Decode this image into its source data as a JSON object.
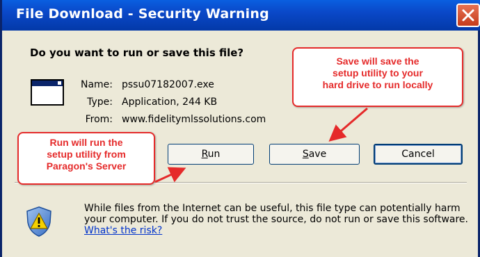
{
  "window": {
    "title": "File Download - Security Warning"
  },
  "dialog": {
    "question": "Do you want to run or save this file?",
    "name_label": "Name:",
    "name_value": "pssu07182007.exe",
    "type_label": "Type:",
    "type_value": "Application, 244 KB",
    "from_label": "From:",
    "from_value": "www.fidelitymlssolutions.com"
  },
  "buttons": {
    "run_hotkey": "R",
    "run_rest": "un",
    "save_hotkey": "S",
    "save_rest": "ave",
    "cancel": "Cancel"
  },
  "warning": {
    "text": "While files from the Internet can be useful, this file type can potentially harm your computer. If you do not trust the source, do not run or save this software.",
    "link": "What's the risk?"
  },
  "callouts": {
    "save_line1": "Save will save the",
    "save_line2": "setup utility to your",
    "save_line3": "hard drive to run locally",
    "run_line1": "Run will run the",
    "run_line2": "setup utility from",
    "run_line3": "Paragon's Server"
  },
  "colors": {
    "titlebar": "#0A48C8",
    "callout": "#E52A2A",
    "dialog_bg": "#ECE9D8"
  },
  "icons": {
    "close": "close-icon",
    "file": "application-file-icon",
    "shield": "security-shield-icon"
  }
}
